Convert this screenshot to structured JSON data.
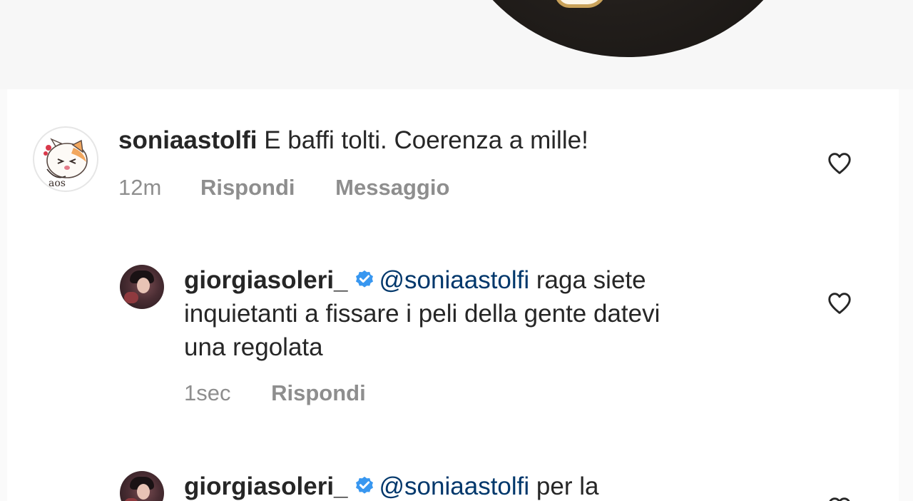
{
  "comments": [
    {
      "username": "soniaastolfi",
      "text": "E baffi tolti. Coerenza a mille!",
      "time": "12m",
      "reply_label": "Rispondi",
      "message_label": "Messaggio"
    },
    {
      "username": "giorgiasoleri_",
      "mention": "@soniaastolfi",
      "text_line1": "raga siete",
      "text_line2": "inquietanti a fissare i peli della gente datevi",
      "text_line3": "una regolata",
      "time": "1sec",
      "reply_label": "Rispondi"
    },
    {
      "username": "giorgiasoleri_",
      "mention": "@soniaastolfi",
      "text_line1": "per la"
    }
  ],
  "icons": {
    "like": "heart-outline-icon",
    "verified": "verified-badge-icon"
  },
  "colors": {
    "text": "#262626",
    "secondary": "#8e8e8e",
    "mention": "#00376b",
    "verified": "#3897f0",
    "background": "#ffffff"
  }
}
